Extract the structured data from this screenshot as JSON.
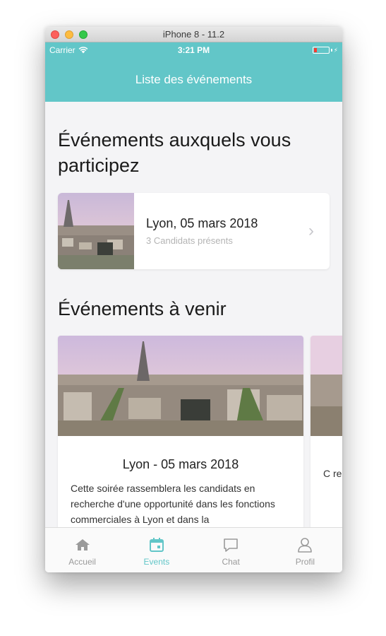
{
  "window": {
    "title": "iPhone 8 - 11.2"
  },
  "status_bar": {
    "carrier": "Carrier",
    "time": "3:21 PM"
  },
  "nav": {
    "title": "Liste des événements"
  },
  "participating": {
    "heading": "Événements auxquels vous participez",
    "event": {
      "title": "Lyon, 05 mars 2018",
      "subtitle": "3 Candidats présents"
    }
  },
  "upcoming": {
    "heading": "Événements à venir",
    "cards": [
      {
        "title": "Lyon - 05 mars 2018",
        "description": "Cette soirée rassemblera les candidats en recherche d'une opportunité dans les fonctions commerciales à Lyon et dans la"
      },
      {
        "title": "",
        "description": "C re fo"
      }
    ]
  },
  "tabs": [
    {
      "label": "Accueil",
      "icon": "home-icon",
      "active": false
    },
    {
      "label": "Events",
      "icon": "calendar-icon",
      "active": true
    },
    {
      "label": "Chat",
      "icon": "chat-icon",
      "active": false
    },
    {
      "label": "Profil",
      "icon": "profile-icon",
      "active": false
    }
  ],
  "colors": {
    "accent": "#62c6c8",
    "inactive": "#9a9a9a"
  }
}
